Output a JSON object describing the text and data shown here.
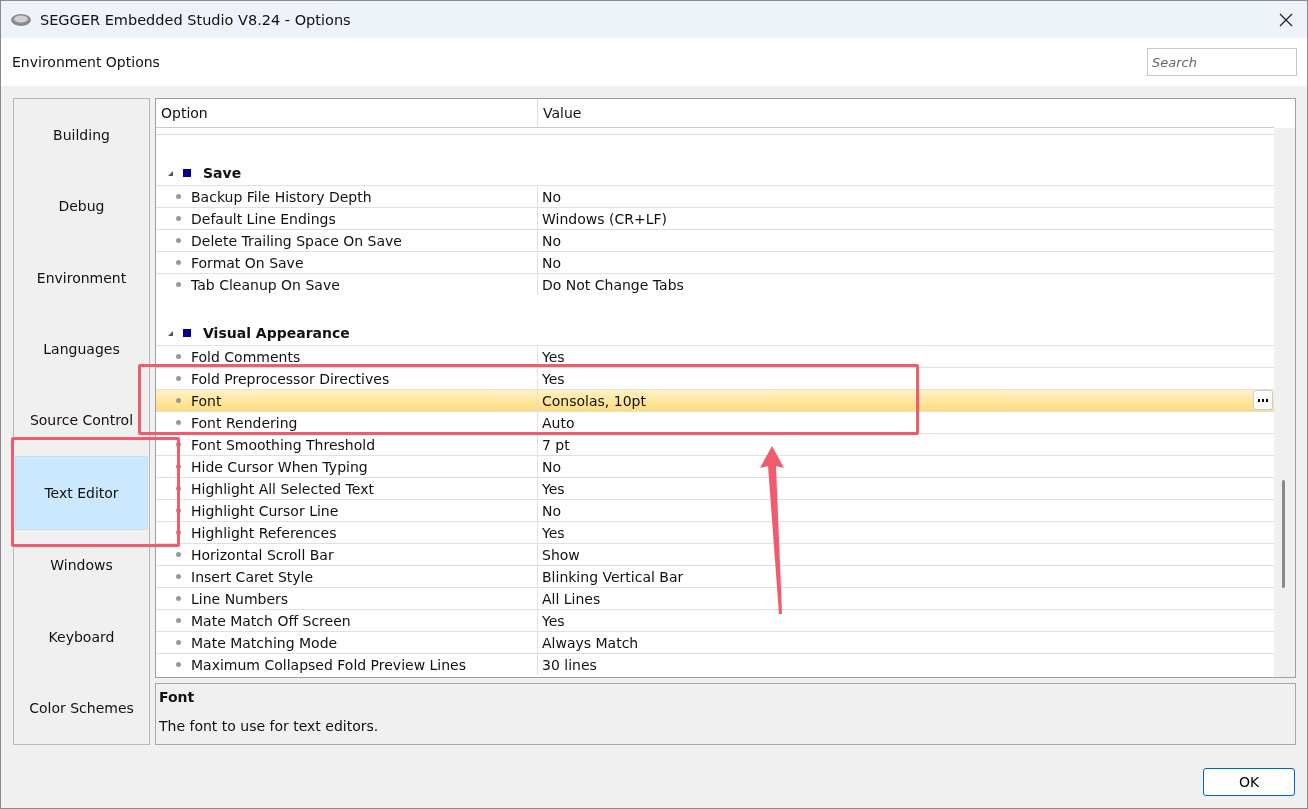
{
  "window": {
    "title": "SEGGER Embedded Studio V8.24 - Options"
  },
  "header": {
    "title": "Environment Options",
    "search": {
      "placeholder": "Search"
    }
  },
  "sidebar": {
    "items": [
      {
        "label": "Building",
        "selected": false
      },
      {
        "label": "Debug",
        "selected": false
      },
      {
        "label": "Environment",
        "selected": false
      },
      {
        "label": "Languages",
        "selected": false
      },
      {
        "label": "Source Control",
        "selected": false
      },
      {
        "label": "Text Editor",
        "selected": true
      },
      {
        "label": "Windows",
        "selected": false
      },
      {
        "label": "Keyboard",
        "selected": false
      },
      {
        "label": "Color Schemes",
        "selected": false
      }
    ]
  },
  "table": {
    "columns": [
      "Option",
      "Value"
    ],
    "groups": [
      {
        "title": "Save",
        "expanded": true,
        "rows": [
          {
            "option": "Backup File History Depth",
            "value": "No",
            "selected": false
          },
          {
            "option": "Default Line Endings",
            "value": "Windows (CR+LF)",
            "selected": false
          },
          {
            "option": "Delete Trailing Space On Save",
            "value": "No",
            "selected": false
          },
          {
            "option": "Format On Save",
            "value": "No",
            "selected": false
          },
          {
            "option": "Tab Cleanup On Save",
            "value": "Do Not Change Tabs",
            "selected": false
          }
        ]
      },
      {
        "title": "Visual Appearance",
        "expanded": true,
        "rows": [
          {
            "option": "Fold Comments",
            "value": "Yes",
            "selected": false
          },
          {
            "option": "Fold Preprocessor Directives",
            "value": "Yes",
            "selected": false
          },
          {
            "option": "Font",
            "value": "Consolas, 10pt",
            "selected": true
          },
          {
            "option": "Font Rendering",
            "value": "Auto",
            "selected": false
          },
          {
            "option": "Font Smoothing Threshold",
            "value": "7 pt",
            "selected": false
          },
          {
            "option": "Hide Cursor When Typing",
            "value": "No",
            "selected": false
          },
          {
            "option": "Highlight All Selected Text",
            "value": "Yes",
            "selected": false
          },
          {
            "option": "Highlight Cursor Line",
            "value": "No",
            "selected": false
          },
          {
            "option": "Highlight References",
            "value": "Yes",
            "selected": false
          },
          {
            "option": "Horizontal Scroll Bar",
            "value": "Show",
            "selected": false
          },
          {
            "option": "Insert Caret Style",
            "value": "Blinking Vertical Bar",
            "selected": false
          },
          {
            "option": "Line Numbers",
            "value": "All Lines",
            "selected": false
          },
          {
            "option": "Mate Match Off Screen",
            "value": "Yes",
            "selected": false
          },
          {
            "option": "Mate Matching Mode",
            "value": "Always Match",
            "selected": false
          },
          {
            "option": "Maximum Collapsed Fold Preview Lines",
            "value": "30 lines",
            "selected": false
          }
        ]
      }
    ]
  },
  "description": {
    "title": "Font",
    "text": "The font to use for text editors."
  },
  "buttons": [
    "OK"
  ]
}
